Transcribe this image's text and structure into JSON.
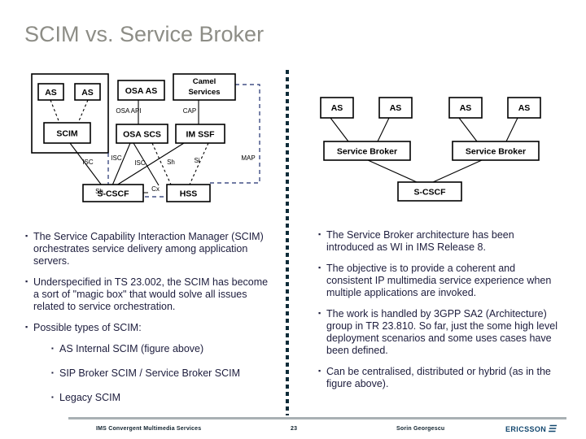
{
  "slide": {
    "title": "SCIM vs. Service Broker",
    "title_color": "#8d8d86",
    "background": "#ffffff",
    "divider_color": "#0e2c39"
  },
  "diagram_left": {
    "name": "AS Internal SCIM reference architecture",
    "nodes": {
      "as1": "AS",
      "as2": "AS",
      "scim": "SCIM",
      "osa_as": "OSA AS",
      "osa_scs": "OSA SCS",
      "camel": "Camel Services",
      "camel_line1": "Camel",
      "camel_line2": "Services",
      "im_ssf": "IM SSF",
      "scscf": "S-CSCF",
      "hss": "HSS"
    },
    "interfaces": {
      "osa_api": "OSA API",
      "cap": "CAP",
      "isc1": "ISC",
      "isc2": "ISC",
      "isc3": "ISC",
      "sh_top": "Sh",
      "si": "Si",
      "map": "MAP",
      "cx": "Cx",
      "sh_left": "Sh"
    }
  },
  "diagram_right": {
    "name": "Distributed Service Broker architecture",
    "nodes": {
      "as1": "AS",
      "as2": "AS",
      "as3": "AS",
      "as4": "AS",
      "broker1": "Service Broker",
      "broker2": "Service Broker",
      "scscf": "S-CSCF"
    }
  },
  "bullets_left": [
    {
      "level": 1,
      "text": "The Service Capability Interaction Manager (SCIM) orchestrates service delivery among application servers."
    },
    {
      "level": 1,
      "text": "Underspecified in TS 23.002, the SCIM has become a sort of \"magic box\" that would solve all issues related to service orchestration."
    },
    {
      "level": 1,
      "text": "Possible types of SCIM:"
    },
    {
      "level": 2,
      "text": "AS Internal SCIM (figure above)"
    },
    {
      "level": 2,
      "text": "SIP Broker SCIM / Service Broker SCIM"
    },
    {
      "level": 2,
      "text": "Legacy SCIM"
    }
  ],
  "bullets_right": [
    {
      "level": 1,
      "text": "The Service Broker architecture has been introduced as WI in IMS Release 8."
    },
    {
      "level": 1,
      "text": "The objective is to provide a coherent and consistent IP multimedia service experience when multiple applications are invoked."
    },
    {
      "level": 1,
      "text": "The work is handled by 3GPP SA2 (Architecture) group in TR 23.810. So far, just the some high level deployment scenarios and some uses cases have been defined."
    },
    {
      "level": 1,
      "text": "Can be centralised, distributed or hybrid (as in the figure above)."
    }
  ],
  "footer": {
    "subject": "IMS Convergent Multimedia Services",
    "page": "23",
    "author": "Sorin Georgescu",
    "logo": "ERICSSON",
    "logo_color": "#11466e"
  }
}
